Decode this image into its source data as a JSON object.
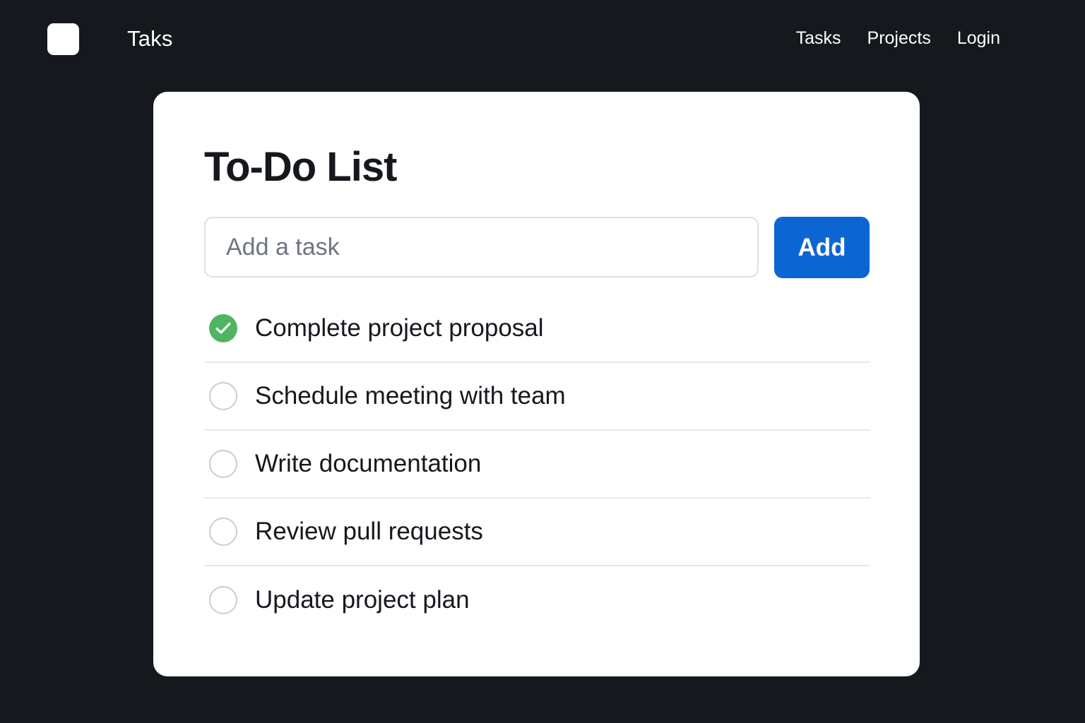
{
  "header": {
    "brand": "Taks",
    "nav": [
      {
        "label": "Tasks"
      },
      {
        "label": "Projects"
      },
      {
        "label": "Login"
      }
    ]
  },
  "main": {
    "title": "To-Do List",
    "input": {
      "placeholder": "Add a task",
      "value": ""
    },
    "add_label": "Add",
    "tasks": [
      {
        "text": "Complete project proposal",
        "completed": true
      },
      {
        "text": "Schedule meeting with team",
        "completed": false
      },
      {
        "text": "Write documentation",
        "completed": false
      },
      {
        "text": "Review pull requests",
        "completed": false
      },
      {
        "text": "Update project plan",
        "completed": false
      }
    ]
  },
  "colors": {
    "background": "#15181d",
    "card": "#ffffff",
    "accent": "#0b66d3",
    "done": "#4fb562"
  },
  "icons": {
    "logo": "app-logo",
    "done": "check-circle-icon",
    "todo": "empty-circle-icon"
  }
}
